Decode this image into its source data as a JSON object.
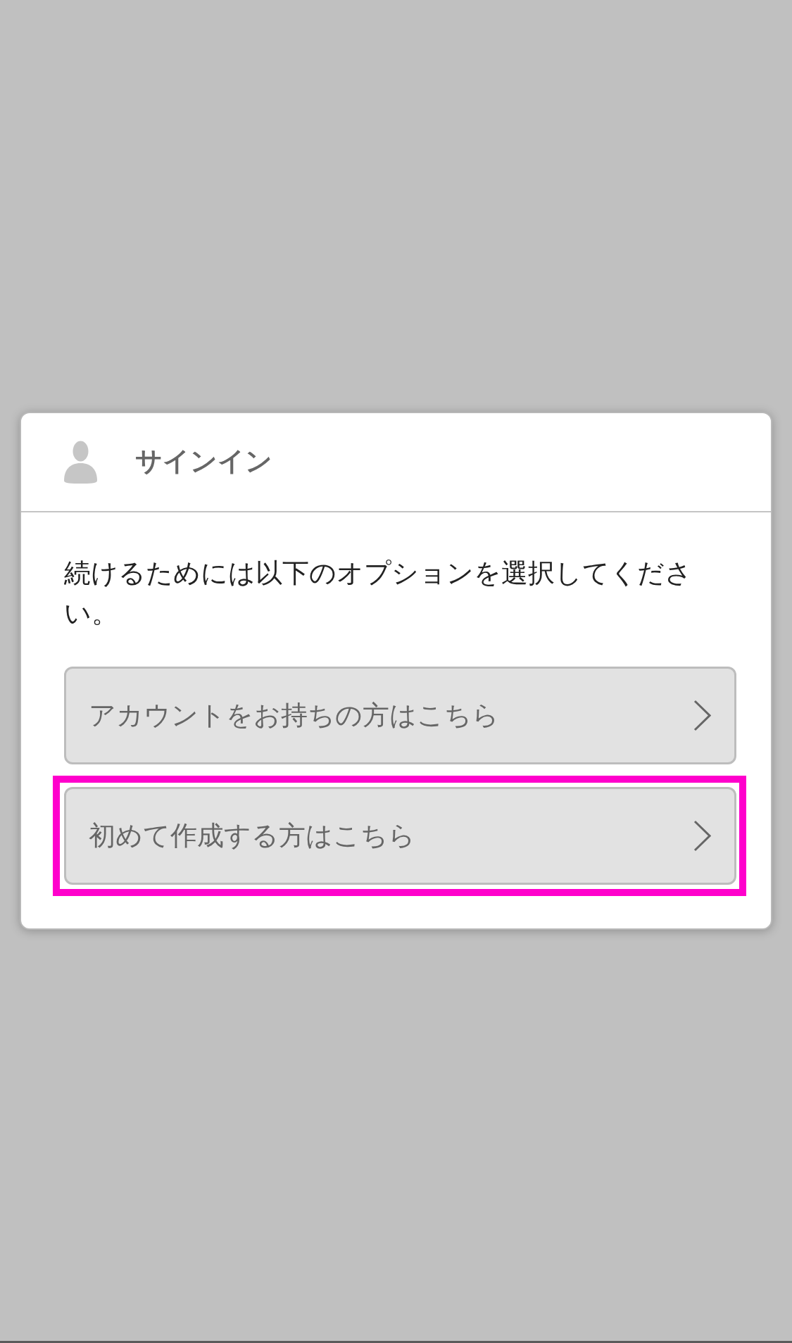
{
  "dialog": {
    "title": "サインイン",
    "message": "続けるためには以下のオプションを選択してください。",
    "options": [
      {
        "label": "アカウントをお持ちの方はこちら",
        "highlighted": false
      },
      {
        "label": "初めて作成する方はこちら",
        "highlighted": true
      }
    ]
  }
}
